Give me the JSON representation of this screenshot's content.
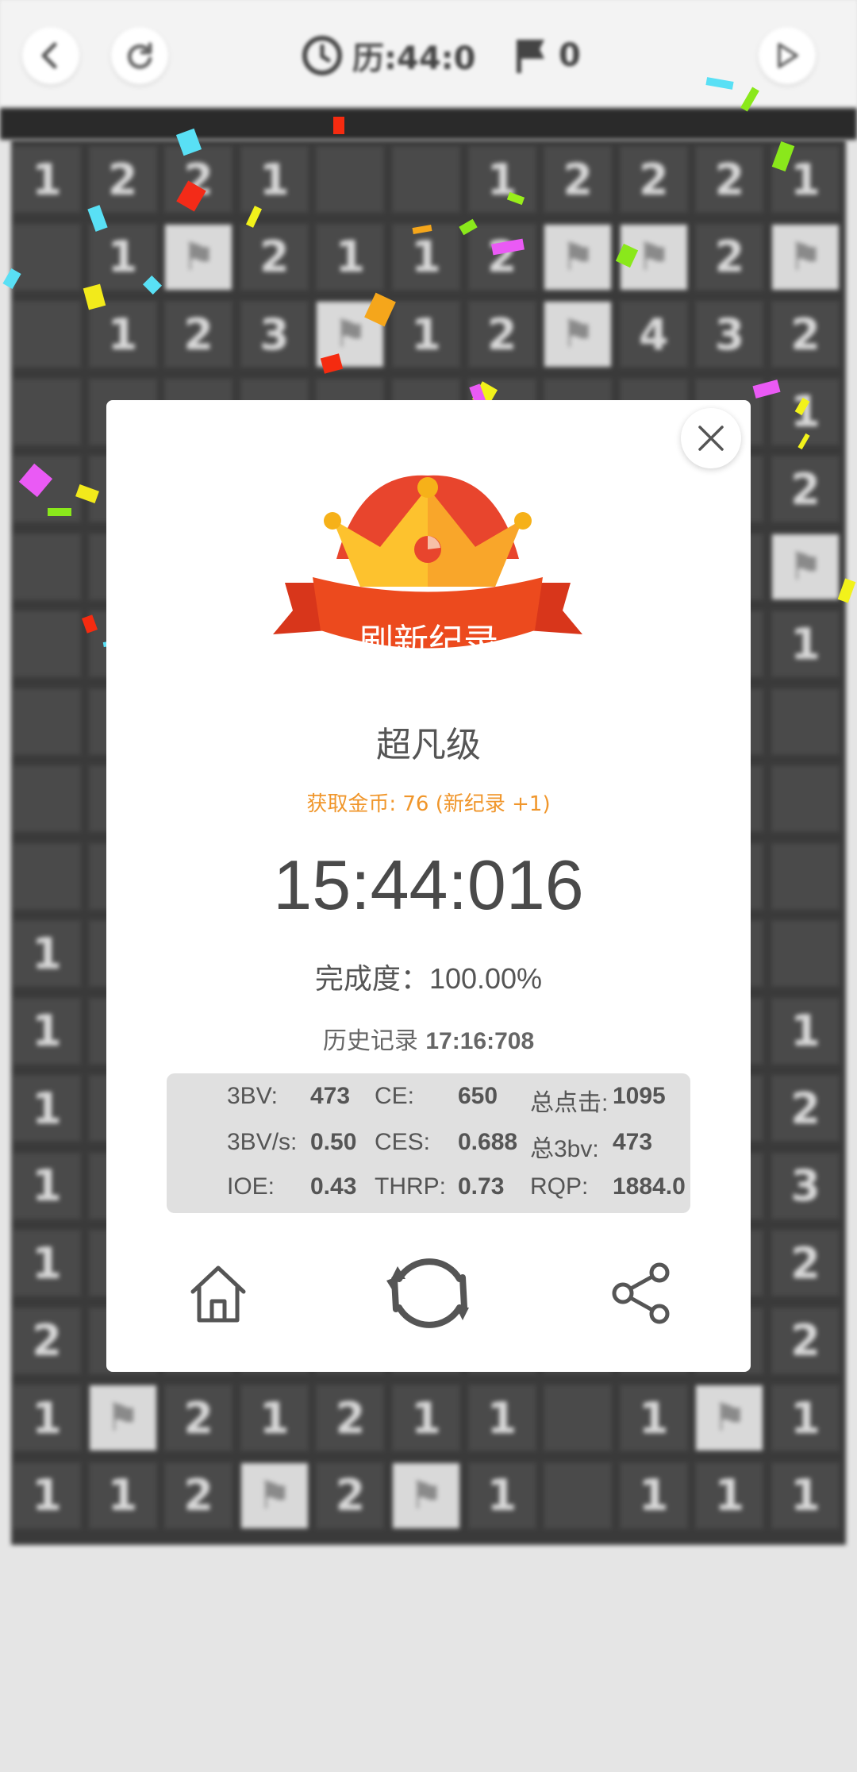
{
  "topbar": {
    "timer_text": "历:44:0",
    "flags_text": "0"
  },
  "board": {
    "rows": [
      [
        "1",
        "2",
        "2",
        "1",
        "",
        "",
        "1",
        "2",
        "2",
        "2",
        "1"
      ],
      [
        "",
        "1",
        "F",
        "2",
        "1",
        "1",
        "2",
        "F",
        "F",
        "2",
        "F"
      ],
      [
        "",
        "1",
        "2",
        "3",
        "F",
        "1",
        "2",
        "F",
        "4",
        "3",
        "2"
      ],
      [
        "",
        "",
        "",
        "",
        "",
        "",
        "",
        "",
        "",
        "",
        "1"
      ],
      [
        "",
        "",
        "",
        "",
        "",
        "",
        "",
        "",
        "",
        "",
        "2"
      ],
      [
        "",
        "",
        "",
        "",
        "",
        "",
        "",
        "",
        "",
        "",
        "F"
      ],
      [
        "",
        "",
        "",
        "",
        "",
        "",
        "",
        "",
        "",
        "",
        "1"
      ],
      [
        "",
        "",
        "",
        "",
        "",
        "",
        "",
        "",
        "",
        "",
        ""
      ],
      [
        "",
        "",
        "",
        "",
        "",
        "",
        "",
        "",
        "",
        "",
        ""
      ],
      [
        "",
        "",
        "",
        "",
        "",
        "",
        "",
        "",
        "",
        "",
        ""
      ],
      [
        "1",
        "",
        "",
        "",
        "",
        "",
        "",
        "",
        "",
        "",
        ""
      ],
      [
        "1",
        "",
        "",
        "",
        "",
        "",
        "",
        "",
        "",
        "",
        "1"
      ],
      [
        "1",
        "",
        "",
        "",
        "",
        "",
        "",
        "",
        "",
        "",
        "2"
      ],
      [
        "1",
        "",
        "",
        "",
        "",
        "",
        "",
        "",
        "",
        "",
        "3"
      ],
      [
        "1",
        "",
        "",
        "",
        "",
        "",
        "",
        "",
        "",
        "",
        "2"
      ],
      [
        "2",
        "",
        "",
        "",
        "",
        "",
        "",
        "",
        "",
        "",
        "2"
      ],
      [
        "1",
        "F",
        "2",
        "1",
        "2",
        "1",
        "1",
        "",
        "1",
        "F",
        "1"
      ],
      [
        "1",
        "1",
        "2",
        "F",
        "2",
        "F",
        "1",
        "",
        "1",
        "1",
        "1"
      ]
    ]
  },
  "modal": {
    "banner": "刷新纪录",
    "level": "超凡级",
    "coins": "获取金币: 76 (新纪录 +1)",
    "time": "15:44:016",
    "completion_label": "完成度：",
    "completion_value": "100.00%",
    "history_label": "历史记录 ",
    "history_value": "17:16:708",
    "stats": [
      {
        "k": "3BV:",
        "v": "473"
      },
      {
        "k": "CE:",
        "v": "650"
      },
      {
        "k": "总点击:",
        "v": "1095"
      },
      {
        "k": "3BV/s:",
        "v": "0.50"
      },
      {
        "k": "CES:",
        "v": "0.688"
      },
      {
        "k": "总3bv:",
        "v": "473"
      },
      {
        "k": "IOE:",
        "v": "0.43"
      },
      {
        "k": "THRP:",
        "v": "0.73"
      },
      {
        "k": "RQP:",
        "v": "1884.0"
      }
    ]
  },
  "icons": {
    "back": "back-icon",
    "restart": "restart-icon",
    "clock": "clock-icon",
    "flag": "flag-icon",
    "play": "play-icon",
    "close": "close-icon",
    "crown": "crown-icon",
    "home": "home-icon",
    "replay": "replay-icon",
    "share": "share-icon"
  },
  "colors": {
    "banner_red": "#e84320",
    "crown_gold": "#fdbf2d",
    "coins_orange": "#f0962b"
  }
}
